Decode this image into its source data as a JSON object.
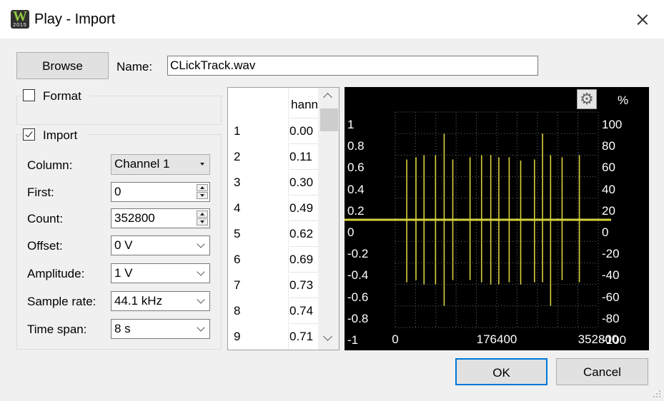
{
  "window": {
    "title": "Play - Import",
    "icon": "waveforms-2015-icon",
    "icon_text": "W",
    "icon_year": "2015"
  },
  "file": {
    "browse_label": "Browse",
    "name_label": "Name:",
    "name_value": "CLickTrack.wav"
  },
  "format": {
    "label": "Format",
    "checked": false
  },
  "import": {
    "label": "Import",
    "checked": true,
    "column": {
      "label": "Column:",
      "value": "Channel 1"
    },
    "first": {
      "label": "First:",
      "value": "0"
    },
    "count": {
      "label": "Count:",
      "value": "352800"
    },
    "offset": {
      "label": "Offset:",
      "value": "0 V"
    },
    "amplitude": {
      "label": "Amplitude:",
      "value": "1 V"
    },
    "sample_rate": {
      "label": "Sample rate:",
      "value": "44.1 kHz"
    },
    "time_span": {
      "label": "Time span:",
      "value": "8 s"
    }
  },
  "table": {
    "column_header": "hann",
    "rows": [
      {
        "n": "1",
        "v": "0.00"
      },
      {
        "n": "2",
        "v": "0.11"
      },
      {
        "n": "3",
        "v": "0.30"
      },
      {
        "n": "4",
        "v": "0.49"
      },
      {
        "n": "5",
        "v": "0.62"
      },
      {
        "n": "6",
        "v": "0.69"
      },
      {
        "n": "7",
        "v": "0.73"
      },
      {
        "n": "8",
        "v": "0.74"
      },
      {
        "n": "9",
        "v": "0.71"
      }
    ]
  },
  "preview": {
    "units_label": "%",
    "y_left_ticks": [
      "1",
      "0.8",
      "0.6",
      "0.4",
      "0.2",
      "0",
      "-0.2",
      "-0.4",
      "-0.6",
      "-0.8",
      "-1"
    ],
    "y_right_ticks": [
      "100",
      "80",
      "60",
      "40",
      "20",
      "0",
      "-20",
      "-40",
      "-60",
      "-80",
      "-100"
    ],
    "x_ticks": [
      "0",
      "176400",
      "352800"
    ],
    "colors": {
      "background": "#000000",
      "trace": "#d8d23a",
      "grid": "#6a6a6a",
      "text": "#ffffff"
    }
  },
  "chart_data": {
    "type": "line",
    "xlim": [
      0,
      352800
    ],
    "ylim": [
      -1,
      1
    ],
    "y2lim": [
      -100,
      100
    ],
    "grid": true,
    "x": [
      20000,
      36000,
      50000,
      70000,
      85000,
      100000,
      130000,
      150000,
      166000,
      180000,
      198000,
      218000,
      242000,
      256000,
      270000,
      290000,
      320000
    ],
    "pulse_peaks": [
      0.56,
      0.58,
      0.6,
      0.6,
      0.8,
      0.56,
      0.58,
      0.6,
      0.6,
      0.58,
      0.58,
      0.55,
      0.56,
      0.8,
      0.6,
      0.58,
      0.6
    ],
    "pulse_troughs": [
      -0.58,
      -0.56,
      -0.6,
      -0.6,
      -0.8,
      -0.56,
      -0.56,
      -0.58,
      -0.6,
      -0.6,
      -0.58,
      -0.6,
      -0.58,
      -0.58,
      -0.8,
      -0.56,
      -0.58
    ]
  },
  "buttons": {
    "ok": "OK",
    "cancel": "Cancel"
  }
}
